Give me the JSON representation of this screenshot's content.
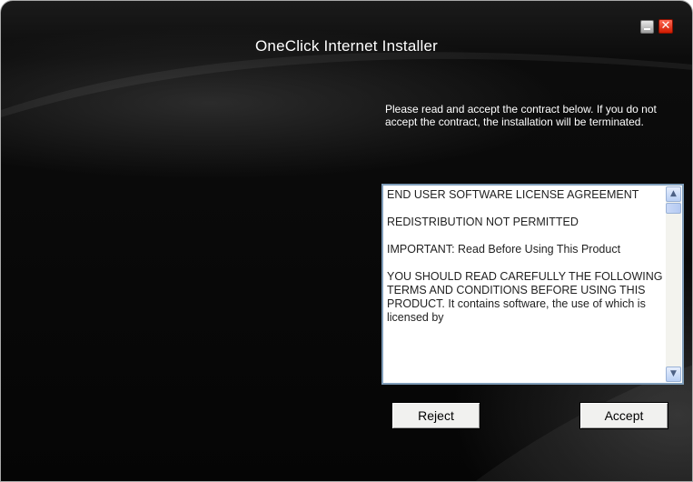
{
  "window": {
    "title": "OneClick Internet Installer",
    "controls": {
      "minimize_icon": "minimize-icon",
      "close_icon": "close-icon",
      "close_glyph": "✕"
    }
  },
  "instructions": "Please read and accept the contract below. If you do not accept the contract, the installation will be terminated.",
  "license": {
    "paragraphs": [
      "END USER SOFTWARE LICENSE AGREEMENT",
      "REDISTRIBUTION NOT PERMITTED",
      "IMPORTANT: Read Before Using This Product",
      "YOU SHOULD READ CAREFULLY THE FOLLOWING TERMS AND CONDITIONS BEFORE USING THIS PRODUCT.  It contains software, the use of which is licensed by"
    ],
    "scroll_up_glyph": "▲",
    "scroll_down_glyph": "▼"
  },
  "buttons": {
    "reject_label": "Reject",
    "accept_label": "Accept"
  },
  "colors": {
    "background": "#050505",
    "text": "#ffffff",
    "close_button": "#d11b00",
    "scrollbar_accent": "#bad0f5"
  }
}
